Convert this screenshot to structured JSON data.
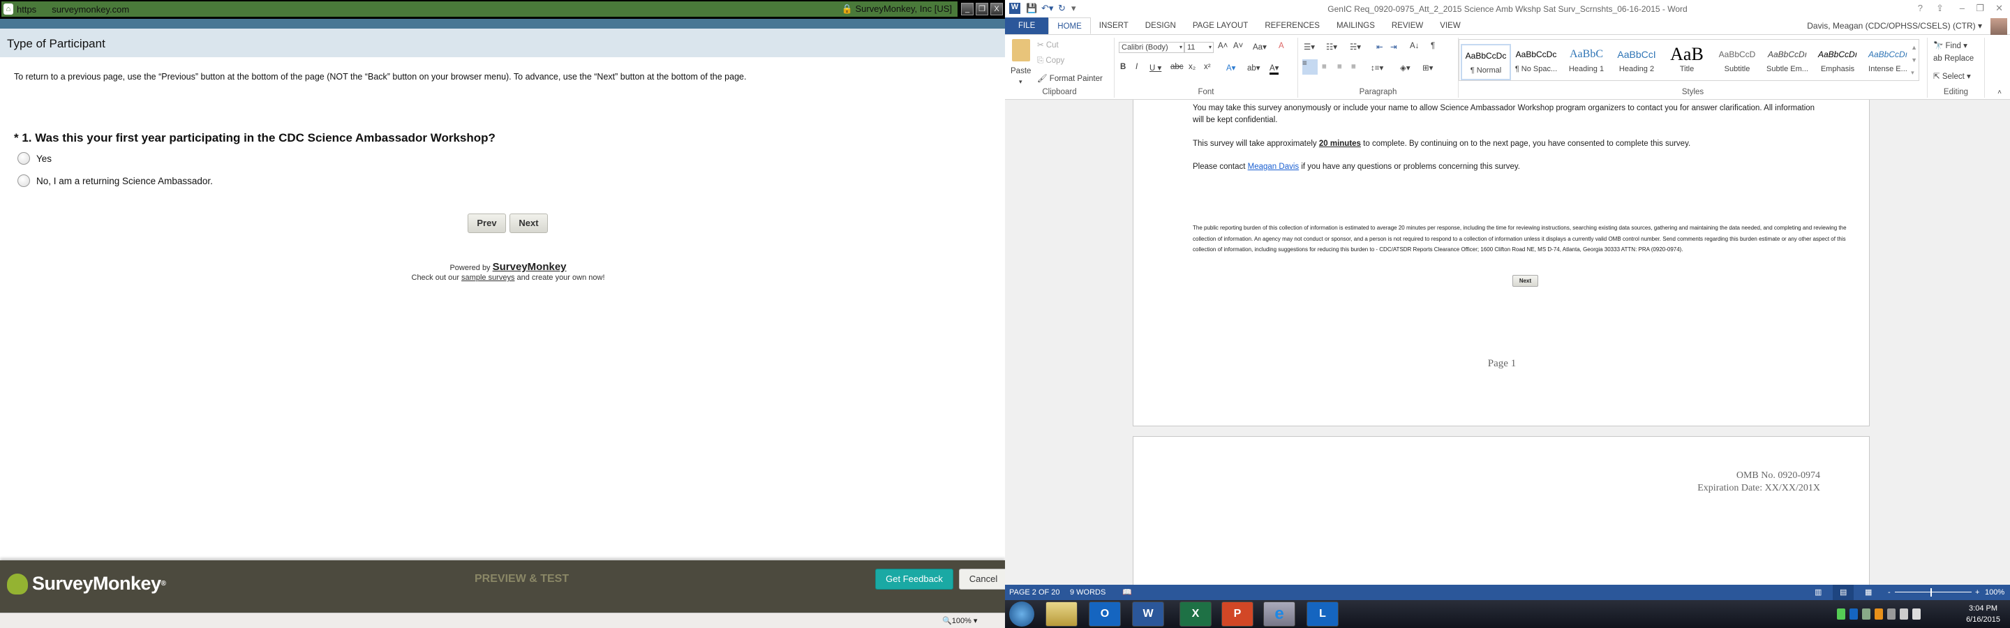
{
  "browser": {
    "url_scheme": "https",
    "url_host": "surveymonkey.com",
    "cert_owner": "SurveyMonkey, Inc [US]",
    "window_buttons": [
      "minimize",
      "restore",
      "close"
    ],
    "page_title": "Type of Participant",
    "instructions": "To return to a previous page, use the “Previous” button at the bottom of the page (NOT the “Back” button on your browser menu). To advance, use the “Next” button at the bottom of the page.",
    "question": "* 1. Was this your first year participating in the CDC Science Ambassador Workshop?",
    "options": [
      "Yes",
      "No, I am a returning Science Ambassador."
    ],
    "prev_label": "Prev",
    "next_label": "Next",
    "powered_by": "Powered by",
    "powered_brand": "SurveyMonkey",
    "checkout_pre": "Check out our",
    "checkout_link": "sample surveys",
    "checkout_post": "and create your own now!",
    "footer": {
      "logo": "SurveyMonkey",
      "mode": "PREVIEW & TEST",
      "feedback_label": "Get Feedback",
      "cancel_label": "Cancel"
    },
    "zoom": "100%"
  },
  "word": {
    "title": "GenIC Req_0920-0975_Att_2_2015 Science Amb Wkshp Sat Surv_Scrnshts_06-16-2015 - Word",
    "tabs": [
      "FILE",
      "HOME",
      "INSERT",
      "DESIGN",
      "PAGE LAYOUT",
      "REFERENCES",
      "MAILINGS",
      "REVIEW",
      "VIEW"
    ],
    "user": "Davis, Meagan (CDC/OPHSS/CSELS) (CTR)",
    "clipboard": {
      "paste": "Paste",
      "cut": "Cut",
      "copy": "Copy",
      "format_painter": "Format Painter",
      "label": "Clipboard"
    },
    "font": {
      "name": "Calibri (Body)",
      "size": "11",
      "label": "Font"
    },
    "paragraph_label": "Paragraph",
    "styles": [
      {
        "sample": "AaBbCcDc",
        "name": "¶ Normal"
      },
      {
        "sample": "AaBbCcDc",
        "name": "¶ No Spac..."
      },
      {
        "sample": "AaBbC",
        "name": "Heading 1"
      },
      {
        "sample": "AaBbCcI",
        "name": "Heading 2"
      },
      {
        "sample": "AaB",
        "name": "Title"
      },
      {
        "sample": "AaBbCcD",
        "name": "Subtitle"
      },
      {
        "sample": "AaBbCcDı",
        "name": "Subtle Em..."
      },
      {
        "sample": "AaBbCcDı",
        "name": "Emphasis"
      },
      {
        "sample": "AaBbCcDı",
        "name": "Intense E..."
      }
    ],
    "styles_label": "Styles",
    "editing": {
      "find": "Find",
      "replace": "Replace",
      "select": "Select",
      "label": "Editing"
    },
    "doc": {
      "para1": "You may take this survey anonymously or include your name to allow Science Ambassador Workshop program organizers to contact you for answer clarification. All information will be kept confidential.",
      "para2_pre": "This survey will take approximately",
      "para2_bold": "20 minutes",
      "para2_post": "to complete. By continuing on to the next page, you have consented to complete this survey.",
      "para3_pre": "Please contact",
      "para3_link": "Meagan Davis",
      "para3_post": "if you have any questions or problems concerning this survey.",
      "legal": "The public reporting burden of this collection of information is estimated to average 20 minutes per response, including the time for reviewing instructions, searching existing data sources, gathering and maintaining the data needed, and completing and reviewing the collection of information. An agency may not conduct or sponsor, and a person is not required to respond to a collection of information unless it displays a currently valid OMB control number. Send comments regarding this burden estimate or any other aspect of this collection of information, including suggestions for reducing this burden to - CDC/ATSDR Reports Clearance Officer; 1600 Clifton Road NE, MS D-74, Atlanta, Georgia 30333 ATTN: PRA (0920-0974).",
      "next_label": "Next",
      "page_footer": "Page 1",
      "omb": "OMB No. 0920-0974",
      "expiration": "Expiration Date:  XX/XX/201X"
    },
    "status": {
      "page": "PAGE 2 OF 20",
      "words": "9 WORDS",
      "zoom": "100%"
    }
  },
  "taskbar": {
    "apps": [
      "start",
      "explorer",
      "outlook",
      "word",
      "excel",
      "powerpoint",
      "internet-explorer",
      "lync"
    ],
    "app_letters": {
      "outlook": "O",
      "word": "W",
      "excel": "X",
      "powerpoint": "P",
      "lync": "L"
    },
    "time": "3:04 PM",
    "date": "6/16/2015"
  },
  "colors": {
    "word_blue": "#2b579a",
    "sm_green": "#94b332",
    "feedback_teal": "#1aa9a4",
    "url_green": "#4a7a3a"
  }
}
